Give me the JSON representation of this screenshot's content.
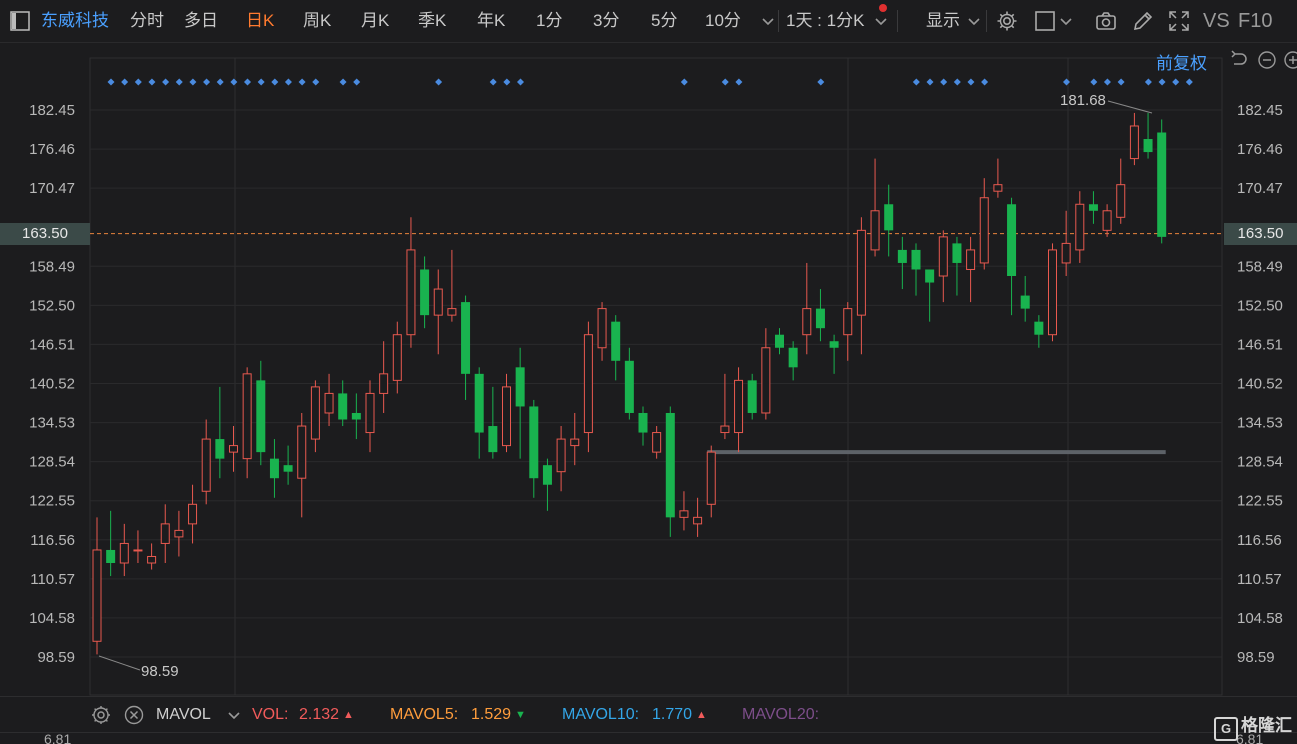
{
  "toolbar": {
    "stock_name": "东威科技",
    "tabs": [
      "分时",
      "多日",
      "日K",
      "周K",
      "月K",
      "季K",
      "年K",
      "1分",
      "3分",
      "5分",
      "10分"
    ],
    "active_tab": "日K",
    "interval_label": "1天 : 1分K",
    "display_label": "显示",
    "vs_label": "VS",
    "f10_label": "F10"
  },
  "chart": {
    "adjust_label": "前复权",
    "current_price": "163.50",
    "y_ticks": [
      "182.45",
      "176.46",
      "170.47",
      "158.49",
      "152.50",
      "146.51",
      "140.52",
      "134.53",
      "128.54",
      "122.55",
      "116.56",
      "110.57",
      "104.58",
      "98.59"
    ],
    "high_label": "181.68",
    "low_label": "98.59",
    "up_color": "#e8594f",
    "down_color": "#19b34f",
    "signal_color": "#4a8be0"
  },
  "chart_data": {
    "type": "candlestick",
    "y_unit": "price",
    "ylim": [
      95.0,
      186.0
    ],
    "current_price": 163.5,
    "high": 181.68,
    "low": 98.59,
    "candles": [
      {
        "o": 101,
        "c": 115,
        "h": 120,
        "l": 99
      },
      {
        "o": 115,
        "c": 113,
        "h": 121,
        "l": 111
      },
      {
        "o": 113,
        "c": 116,
        "h": 119,
        "l": 111
      },
      {
        "o": 115,
        "c": 115,
        "h": 118,
        "l": 113
      },
      {
        "o": 113,
        "c": 114,
        "h": 116,
        "l": 112
      },
      {
        "o": 116,
        "c": 119,
        "h": 122,
        "l": 113
      },
      {
        "o": 117,
        "c": 118,
        "h": 121,
        "l": 114
      },
      {
        "o": 119,
        "c": 122,
        "h": 125,
        "l": 116
      },
      {
        "o": 124,
        "c": 132,
        "h": 135,
        "l": 122
      },
      {
        "o": 132,
        "c": 129,
        "h": 140,
        "l": 126
      },
      {
        "o": 130,
        "c": 131,
        "h": 134,
        "l": 127
      },
      {
        "o": 129,
        "c": 142,
        "h": 143,
        "l": 126
      },
      {
        "o": 141,
        "c": 130,
        "h": 144,
        "l": 128
      },
      {
        "o": 129,
        "c": 126,
        "h": 132,
        "l": 123
      },
      {
        "o": 128,
        "c": 127,
        "h": 131,
        "l": 125
      },
      {
        "o": 126,
        "c": 134,
        "h": 136,
        "l": 120
      },
      {
        "o": 132,
        "c": 140,
        "h": 141,
        "l": 130
      },
      {
        "o": 136,
        "c": 139,
        "h": 142,
        "l": 134
      },
      {
        "o": 139,
        "c": 135,
        "h": 141,
        "l": 134
      },
      {
        "o": 136,
        "c": 135,
        "h": 139,
        "l": 132
      },
      {
        "o": 133,
        "c": 139,
        "h": 141,
        "l": 130
      },
      {
        "o": 139,
        "c": 142,
        "h": 147,
        "l": 136
      },
      {
        "o": 141,
        "c": 148,
        "h": 150,
        "l": 139
      },
      {
        "o": 148,
        "c": 161,
        "h": 166,
        "l": 146
      },
      {
        "o": 158,
        "c": 151,
        "h": 160,
        "l": 149
      },
      {
        "o": 151,
        "c": 155,
        "h": 158,
        "l": 145
      },
      {
        "o": 151,
        "c": 152,
        "h": 161,
        "l": 150
      },
      {
        "o": 153,
        "c": 142,
        "h": 154,
        "l": 138
      },
      {
        "o": 142,
        "c": 133,
        "h": 143,
        "l": 129
      },
      {
        "o": 134,
        "c": 130,
        "h": 140,
        "l": 129
      },
      {
        "o": 131,
        "c": 140,
        "h": 142,
        "l": 130
      },
      {
        "o": 143,
        "c": 137,
        "h": 146,
        "l": 129
      },
      {
        "o": 137,
        "c": 126,
        "h": 138,
        "l": 123
      },
      {
        "o": 128,
        "c": 125,
        "h": 129,
        "l": 121
      },
      {
        "o": 127,
        "c": 132,
        "h": 134,
        "l": 124
      },
      {
        "o": 131,
        "c": 132,
        "h": 136,
        "l": 128
      },
      {
        "o": 133,
        "c": 148,
        "h": 150,
        "l": 130
      },
      {
        "o": 146,
        "c": 152,
        "h": 153,
        "l": 144
      },
      {
        "o": 150,
        "c": 144,
        "h": 151,
        "l": 141
      },
      {
        "o": 144,
        "c": 136,
        "h": 146,
        "l": 135
      },
      {
        "o": 136,
        "c": 133,
        "h": 137,
        "l": 131
      },
      {
        "o": 130,
        "c": 133,
        "h": 134,
        "l": 129
      },
      {
        "o": 136,
        "c": 120,
        "h": 137,
        "l": 117
      },
      {
        "o": 120,
        "c": 121,
        "h": 124,
        "l": 118
      },
      {
        "o": 119,
        "c": 120,
        "h": 123,
        "l": 117
      },
      {
        "o": 122,
        "c": 130,
        "h": 131,
        "l": 120
      },
      {
        "o": 133,
        "c": 134,
        "h": 142,
        "l": 132
      },
      {
        "o": 133,
        "c": 141,
        "h": 143,
        "l": 130
      },
      {
        "o": 141,
        "c": 136,
        "h": 142,
        "l": 135
      },
      {
        "o": 136,
        "c": 146,
        "h": 149,
        "l": 135
      },
      {
        "o": 148,
        "c": 146,
        "h": 149,
        "l": 145
      },
      {
        "o": 146,
        "c": 143,
        "h": 147,
        "l": 141
      },
      {
        "o": 148,
        "c": 152,
        "h": 159,
        "l": 145
      },
      {
        "o": 152,
        "c": 149,
        "h": 155,
        "l": 147
      },
      {
        "o": 147,
        "c": 146,
        "h": 148,
        "l": 142
      },
      {
        "o": 148,
        "c": 152,
        "h": 153,
        "l": 144
      },
      {
        "o": 151,
        "c": 164,
        "h": 166,
        "l": 145
      },
      {
        "o": 161,
        "c": 167,
        "h": 175,
        "l": 160
      },
      {
        "o": 168,
        "c": 164,
        "h": 171,
        "l": 160
      },
      {
        "o": 161,
        "c": 159,
        "h": 163,
        "l": 155
      },
      {
        "o": 161,
        "c": 158,
        "h": 162,
        "l": 154
      },
      {
        "o": 158,
        "c": 156,
        "h": 158,
        "l": 150
      },
      {
        "o": 157,
        "c": 163,
        "h": 164,
        "l": 153
      },
      {
        "o": 162,
        "c": 159,
        "h": 163,
        "l": 154
      },
      {
        "o": 158,
        "c": 161,
        "h": 163,
        "l": 153
      },
      {
        "o": 159,
        "c": 169,
        "h": 172,
        "l": 158
      },
      {
        "o": 170,
        "c": 171,
        "h": 175,
        "l": 169
      },
      {
        "o": 168,
        "c": 157,
        "h": 169,
        "l": 151
      },
      {
        "o": 154,
        "c": 152,
        "h": 157,
        "l": 150
      },
      {
        "o": 150,
        "c": 148,
        "h": 151,
        "l": 146
      },
      {
        "o": 148,
        "c": 161,
        "h": 162,
        "l": 147
      },
      {
        "o": 159,
        "c": 162,
        "h": 167,
        "l": 157
      },
      {
        "o": 161,
        "c": 168,
        "h": 170,
        "l": 159
      },
      {
        "o": 168,
        "c": 167,
        "h": 170,
        "l": 165
      },
      {
        "o": 164,
        "c": 167,
        "h": 168,
        "l": 163
      },
      {
        "o": 166,
        "c": 171,
        "h": 175,
        "l": 165
      },
      {
        "o": 175,
        "c": 180,
        "h": 182,
        "l": 174
      },
      {
        "o": 178,
        "c": 176,
        "h": 182,
        "l": 175
      },
      {
        "o": 179,
        "c": 163,
        "h": 181,
        "l": 162
      }
    ],
    "signal_marker_candles": [
      0,
      1,
      2,
      3,
      4,
      5,
      6,
      7,
      8,
      9,
      10,
      11,
      12,
      13,
      14,
      15,
      17,
      18,
      24,
      28,
      29,
      30,
      42,
      45,
      46,
      52,
      59,
      60,
      61,
      62,
      63,
      64,
      70,
      72,
      73,
      74,
      76,
      77,
      78,
      79
    ],
    "support_line": {
      "price": 130,
      "from_candle": 45,
      "to_candle": 78
    }
  },
  "volume": {
    "indicator": "MAVOL",
    "vol_label": "VOL:",
    "vol_value": "2.132",
    "mavol5_label": "MAVOL5:",
    "mavol5_value": "1.529",
    "mavol10_label": "MAVOL10:",
    "mavol10_value": "1.770",
    "mavol20_label": "MAVOL20:",
    "axis_top_left": "6.81",
    "axis_top_right": "6.81",
    "vol_color": "#f15b5b",
    "mavol5_color": "#ff9d3c",
    "mavol10_color": "#33a6e8",
    "mavol20_color": "#7d4e8a"
  },
  "watermark": "格隆汇"
}
